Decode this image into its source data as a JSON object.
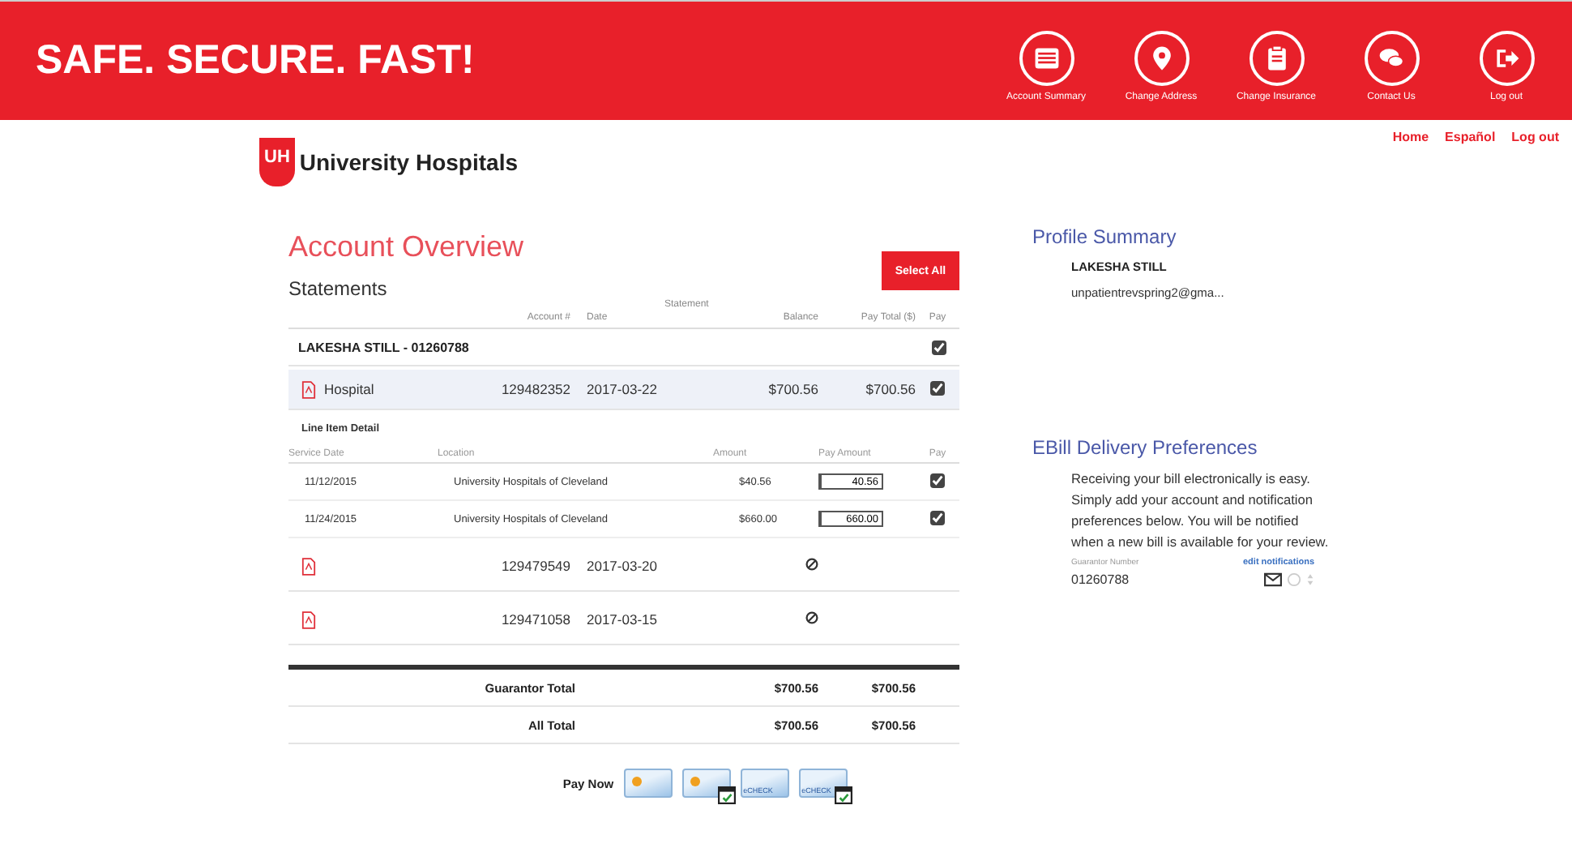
{
  "header": {
    "tagline": "SAFE. SECURE. FAST!",
    "nav": [
      {
        "kind": "summary",
        "label": "Account Summary"
      },
      {
        "kind": "address",
        "label": "Change Address"
      },
      {
        "kind": "insurance",
        "label": "Change Insurance"
      },
      {
        "kind": "contact",
        "label": "Contact Us"
      },
      {
        "kind": "logout",
        "label": "Log out"
      }
    ]
  },
  "logo": {
    "mark": "UH",
    "name": "University Hospitals"
  },
  "top_links": [
    "Home",
    "Español",
    "Log out"
  ],
  "account": {
    "title": "Account Overview",
    "select_all": "Select All",
    "section": "Statements",
    "columns": {
      "group": "Statement",
      "account": "Account #",
      "date": "Date",
      "balance": "Balance",
      "pay_total": "Pay Total ($)",
      "pay": "Pay"
    },
    "guarantor": {
      "label": "LAKESHA STILL - 01260788",
      "checked": true
    },
    "statements": [
      {
        "payable": true,
        "type": "Hospital",
        "account": "129482352",
        "date": "2017-03-22",
        "balance": "$700.56",
        "pay_total": "$700.56",
        "checked": true,
        "expanded": true,
        "detail": {
          "title": "Line Item Detail",
          "columns": [
            "Service Date",
            "Location",
            "Amount",
            "Pay Amount",
            "Pay"
          ],
          "rows": [
            {
              "date": "11/12/2015",
              "location": "University Hospitals of Cleveland",
              "amount": "$40.56",
              "pay_amount": "40.56",
              "checked": true
            },
            {
              "date": "11/24/2015",
              "location": "University Hospitals of Cleveland",
              "amount": "$660.00",
              "pay_amount": "660.00",
              "checked": true
            }
          ]
        }
      },
      {
        "payable": false,
        "account": "129479549",
        "date": "2017-03-20",
        "expanded": false
      },
      {
        "payable": false,
        "account": "129471058",
        "date": "2017-03-15",
        "expanded": false
      }
    ],
    "totals": [
      {
        "label": "Guarantor Total",
        "balance": "$700.56",
        "pay_total": "$700.56"
      },
      {
        "label": "All Total",
        "balance": "$700.56",
        "pay_total": "$700.56"
      }
    ],
    "pay_now": {
      "label": "Pay Now",
      "methods": [
        {
          "kind": "card",
          "scheduled": false
        },
        {
          "kind": "card",
          "scheduled": true
        },
        {
          "kind": "echeck",
          "label": "eCHECK",
          "scheduled": false
        },
        {
          "kind": "echeck",
          "label": "eCHECK",
          "scheduled": true
        }
      ]
    }
  },
  "profile": {
    "title": "Profile Summary",
    "name": "LAKESHA STILL",
    "email": "unpatientrevspring2@gma..."
  },
  "ebill": {
    "title": "EBill Delivery Preferences",
    "text": "Receiving your bill electronically is easy. Simply add your account and notification preferences below. You will be notified when a new bill is available for your review.",
    "number_label": "Guarantor Number",
    "edit_link": "edit notifications",
    "number": "01260788"
  }
}
